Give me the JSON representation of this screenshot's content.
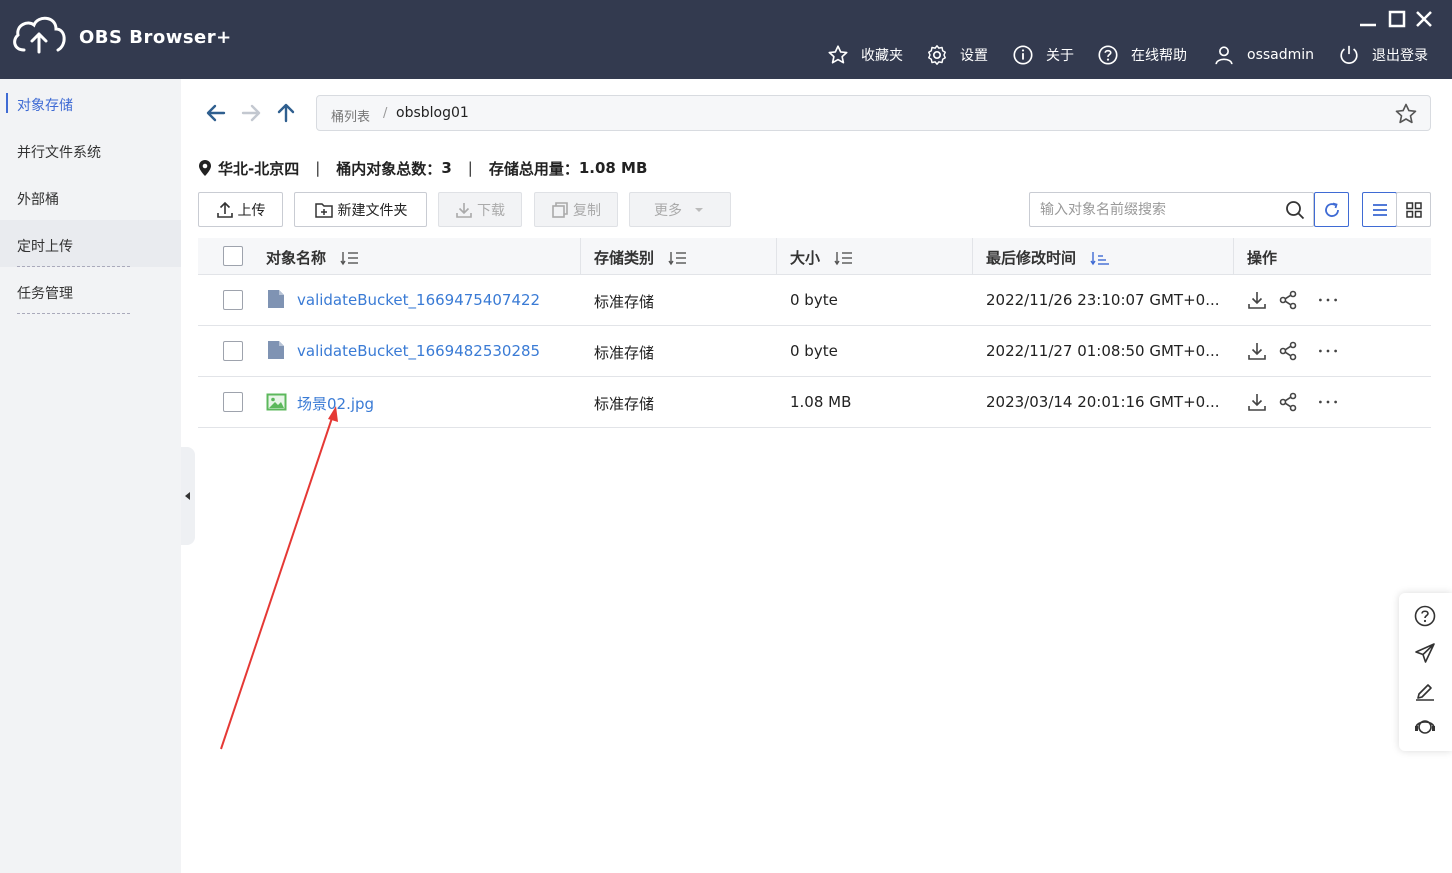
{
  "app": {
    "title": "OBS Browser+",
    "colors": {
      "titlebar": "#333a4f",
      "accent": "#3f6bd4",
      "link": "#3a7bd5",
      "annotation": "#e53935"
    }
  },
  "topnav": {
    "favorites": "收藏夹",
    "settings": "设置",
    "about": "关于",
    "help": "在线帮助",
    "user": "ossadmin",
    "logout": "退出登录"
  },
  "sidebar": {
    "items": [
      {
        "label": "对象存储"
      },
      {
        "label": "并行文件系统"
      },
      {
        "label": "外部桶"
      },
      {
        "label": "定时上传"
      },
      {
        "label": "任务管理"
      }
    ]
  },
  "breadcrumb": {
    "root": "桶列表",
    "separator": "/",
    "current": "obsblog01"
  },
  "info": {
    "region": "华北-北京四",
    "object_count_label": "桶内对象总数：",
    "object_count": "3",
    "storage_label": "存储总用量：",
    "storage_used": "1.08 MB",
    "divider": "|"
  },
  "toolbar": {
    "upload": "上传",
    "new_folder": "新建文件夹",
    "download": "下载",
    "copy": "复制",
    "more": "更多",
    "search_placeholder": "输入对象名前缀搜索"
  },
  "table": {
    "columns": [
      "对象名称",
      "存储类别",
      "大小",
      "最后修改时间",
      "操作"
    ],
    "rows": [
      {
        "name": "validateBucket_1669475407422",
        "storage": "标准存储",
        "size": "0 byte",
        "modified": "2022/11/26 23:10:07 GMT+0...",
        "icon": "file-icon"
      },
      {
        "name": "validateBucket_1669482530285",
        "storage": "标准存储",
        "size": "0 byte",
        "modified": "2022/11/27 01:08:50 GMT+0...",
        "icon": "file-icon"
      },
      {
        "name": "场景02.jpg",
        "storage": "标准存储",
        "size": "1.08 MB",
        "modified": "2023/03/14 20:01:16 GMT+0...",
        "icon": "image-icon"
      }
    ]
  }
}
